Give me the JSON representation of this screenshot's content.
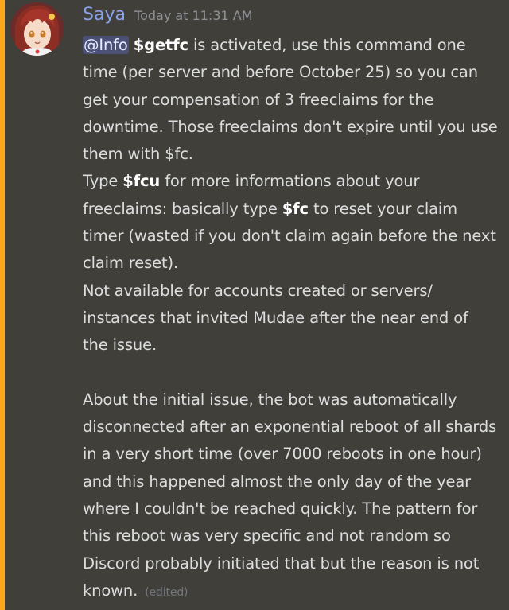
{
  "message": {
    "author": "Saya",
    "timestamp": "Today at 11:31 AM",
    "accent_color": "#faa81a",
    "username_color": "#8aa1e8",
    "avatar_icon": "anime-girl-avatar",
    "mention": "@Info",
    "p1": {
      "cmd": "$getfc",
      "text": " is activated, use this command one time (per server and before October 25) so you can get your compensation of 3 freeclaims for the downtime. Those freeclaims don't expire until you use them with $fc."
    },
    "p2": {
      "pre": "Type ",
      "cmd1": "$fcu",
      "mid": " for more informations about your freeclaims: basically type ",
      "cmd2": "$fc",
      "post": " to reset your claim timer (wasted if you don't claim again before the next claim reset)."
    },
    "p3": "Not available for accounts created or servers/ instances that invited Mudae after the near end of the issue.",
    "p4": "About the initial issue, the bot was automatically disconnected after an exponential reboot of all shards in a very short time (over 7000 reboots in one hour) and this happened almost the only day of the year where I couldn't be reached quickly. The pattern for this reboot was very specific and not random so Discord probably initiated that but the reason is not known.",
    "edited_label": "(edited)"
  }
}
